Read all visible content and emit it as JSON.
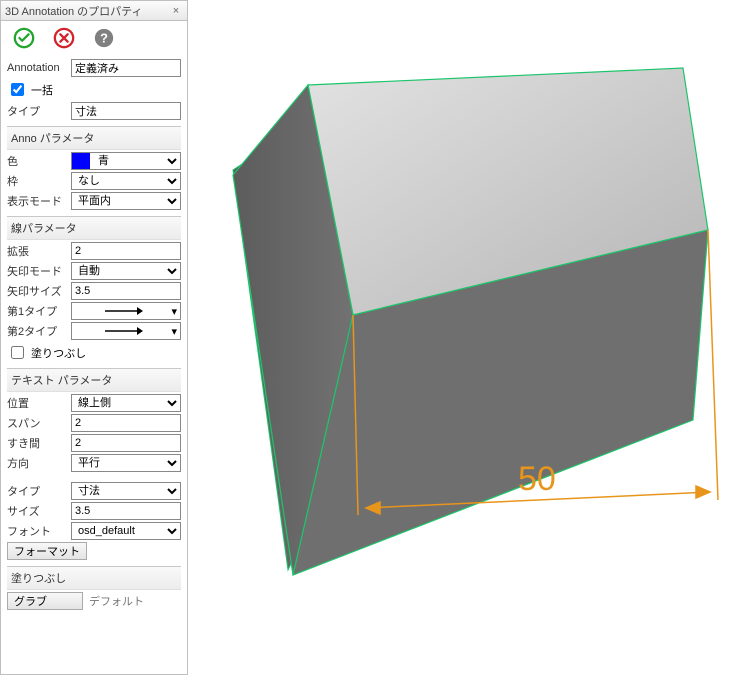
{
  "panel": {
    "title": "3D Annotation のプロパティ",
    "close": "×",
    "top": {
      "annotation_label": "Annotation",
      "annotation_value": "定義済み",
      "batch_label": "一括",
      "type_label": "タイプ",
      "type_value": "寸法"
    },
    "anno": {
      "head": "Anno パラメータ",
      "color_label": "色",
      "color_value": "青",
      "frame_label": "枠",
      "frame_value": "なし",
      "dispmode_label": "表示モード",
      "dispmode_value": "平面内"
    },
    "line": {
      "head": "線パラメータ",
      "ext_label": "拡張",
      "ext_value": "2",
      "arrowmode_label": "矢印モード",
      "arrowmode_value": "自動",
      "arrowsize_label": "矢印サイズ",
      "arrowsize_value": "3.5",
      "type1_label": "第1タイプ",
      "type2_label": "第2タイプ",
      "fill_label": "塗りつぶし"
    },
    "text": {
      "head": "テキスト パラメータ",
      "pos_label": "位置",
      "pos_value": "線上側",
      "span_label": "スパン",
      "span_value": "2",
      "gap_label": "すき間",
      "gap_value": "2",
      "dir_label": "方向",
      "dir_value": "平行",
      "type_label": "タイプ",
      "type_value": "寸法",
      "size_label": "サイズ",
      "size_value": "3.5",
      "font_label": "フォント",
      "font_value": "osd_default",
      "format_btn": "フォーマット"
    },
    "fill": {
      "head": "塗りつぶし",
      "grab_btn": "グラブ",
      "default_label": "デフォルト"
    }
  },
  "viewport": {
    "dimension_value": "50"
  }
}
